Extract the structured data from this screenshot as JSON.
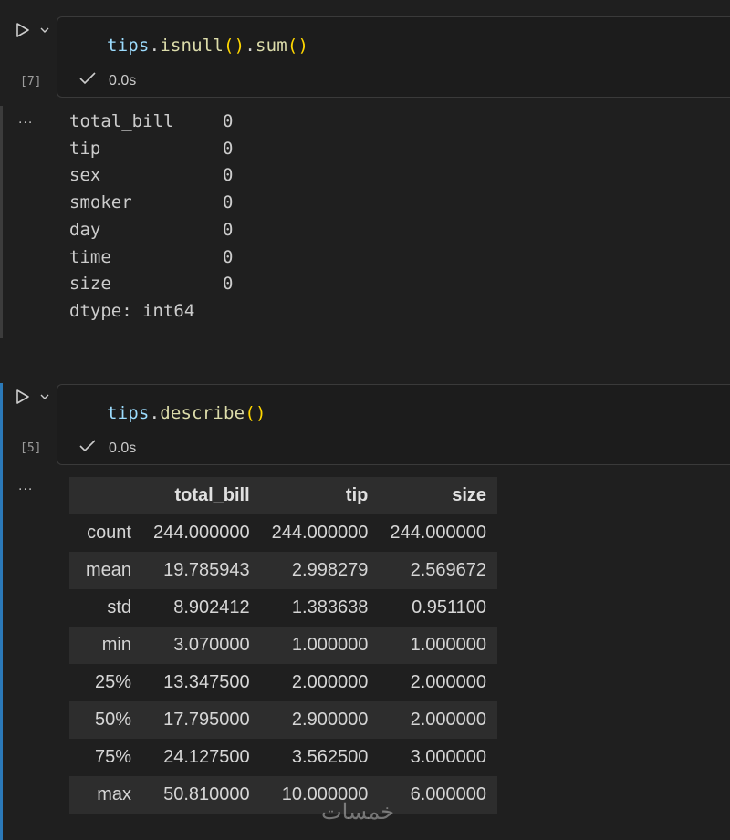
{
  "cells": [
    {
      "exec_count": "[7]",
      "code": {
        "var": "tips",
        "dot1": ".",
        "fn1": "isnull",
        "p1": "()",
        "dot2": ".",
        "fn2": "sum",
        "p2": "()"
      },
      "status_time": "0.0s",
      "output_lines": [
        {
          "name": "total_bill",
          "value": "0"
        },
        {
          "name": "tip",
          "value": "0"
        },
        {
          "name": "sex",
          "value": "0"
        },
        {
          "name": "smoker",
          "value": "0"
        },
        {
          "name": "day",
          "value": "0"
        },
        {
          "name": "time",
          "value": "0"
        },
        {
          "name": "size",
          "value": "0"
        }
      ],
      "output_dtype": "dtype: int64"
    },
    {
      "exec_count": "[5]",
      "code": {
        "var": "tips",
        "dot1": ".",
        "fn1": "describe",
        "p1": "()"
      },
      "status_time": "0.0s",
      "table": {
        "columns": [
          "",
          "total_bill",
          "tip",
          "size"
        ],
        "rows": [
          {
            "index": "count",
            "values": [
              "244.000000",
              "244.000000",
              "244.000000"
            ]
          },
          {
            "index": "mean",
            "values": [
              "19.785943",
              "2.998279",
              "2.569672"
            ]
          },
          {
            "index": "std",
            "values": [
              "8.902412",
              "1.383638",
              "0.951100"
            ]
          },
          {
            "index": "min",
            "values": [
              "3.070000",
              "1.000000",
              "1.000000"
            ]
          },
          {
            "index": "25%",
            "values": [
              "13.347500",
              "2.000000",
              "2.000000"
            ]
          },
          {
            "index": "50%",
            "values": [
              "17.795000",
              "2.900000",
              "2.000000"
            ]
          },
          {
            "index": "75%",
            "values": [
              "24.127500",
              "3.562500",
              "3.000000"
            ]
          },
          {
            "index": "max",
            "values": [
              "50.810000",
              "10.000000",
              "6.000000"
            ]
          }
        ]
      }
    }
  ],
  "output_menu": "...",
  "watermark": "خمسات",
  "colors": {
    "active_bar": "#2b79b8",
    "inactive_bar": "#3c3c3c"
  }
}
